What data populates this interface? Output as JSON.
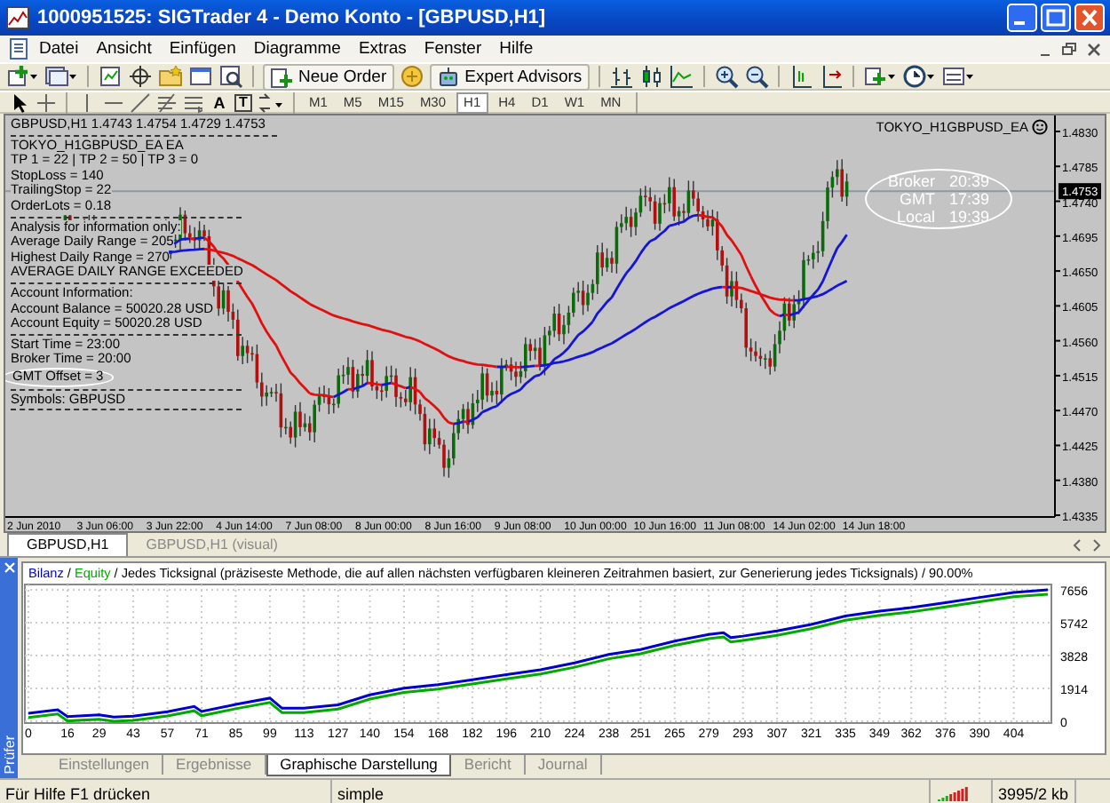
{
  "window": {
    "title": "1000951525: SIGTrader 4 - Demo Konto - [GBPUSD,H1]"
  },
  "menu": [
    "Datei",
    "Ansicht",
    "Einfügen",
    "Diagramme",
    "Extras",
    "Fenster",
    "Hilfe"
  ],
  "toolbar": {
    "buttons": [
      "Neue Order",
      "Expert Advisors"
    ]
  },
  "drawing_tools": [
    {
      "glyph": "A",
      "boxed": false
    },
    {
      "glyph": "T",
      "boxed": true
    }
  ],
  "timeframes": [
    {
      "label": "M1",
      "selected": false
    },
    {
      "label": "M5",
      "selected": false
    },
    {
      "label": "M15",
      "selected": false
    },
    {
      "label": "M30",
      "selected": false
    },
    {
      "label": "H1",
      "selected": true
    },
    {
      "label": "H4",
      "selected": false
    },
    {
      "label": "D1",
      "selected": false
    },
    {
      "label": "W1",
      "selected": false
    },
    {
      "label": "MN",
      "selected": false
    }
  ],
  "chart": {
    "header": "GBPUSD,H1  1.4743 1.4754 1.4729 1.4753",
    "ea_label": "TOKYO_H1GBPUSD_EA",
    "info_groups": [
      [
        {
          "text": "TOKYO_H1GBPUSD_EA EA",
          "circled": false
        },
        {
          "text": "TP 1 = 22 | TP 2 = 50 | TP 3 = 0",
          "circled": false
        },
        {
          "text": "StopLoss = 140",
          "circled": false
        },
        {
          "text": "TrailingStop = 22",
          "circled": false
        },
        {
          "text": "OrderLots = 0.18",
          "circled": false
        }
      ],
      [
        {
          "text": "Analysis for information only:",
          "circled": false
        },
        {
          "text": "Average Daily Range = 205",
          "circled": false
        },
        {
          "text": "Highest Daily Range = 270",
          "circled": false
        },
        {
          "text": "AVERAGE DAILY RANGE EXCEEDED",
          "circled": false
        }
      ],
      [
        {
          "text": "Account Information:",
          "circled": false
        },
        {
          "text": "Account Balance = 50020.28 USD",
          "circled": false
        },
        {
          "text": "Account Equity  = 50020.28 USD",
          "circled": false
        }
      ],
      [
        {
          "text": "Start Time = 23:00",
          "circled": false
        },
        {
          "text": "Broker Time = 20:00",
          "circled": false
        },
        {
          "text": "GMT Offset = 3",
          "circled": true
        }
      ],
      [
        {
          "text": "Symbols: GBPUSD",
          "circled": false
        }
      ]
    ],
    "clock": [
      {
        "label": "Broker",
        "time": "20:39"
      },
      {
        "label": "GMT",
        "time": "17:39"
      },
      {
        "label": "Local",
        "time": "19:39"
      }
    ],
    "price_labels": [
      "1.4830",
      "1.4785",
      "1.4740",
      "1.4695",
      "1.4650",
      "1.4605",
      "1.4560",
      "1.4515",
      "1.4470",
      "1.4425",
      "1.4380",
      "1.4335"
    ],
    "current_price": "1.4753",
    "time_labels": [
      "2 Jun 2010",
      "3 Jun 06:00",
      "3 Jun 22:00",
      "4 Jun 14:00",
      "7 Jun 08:00",
      "8 Jun 00:00",
      "8 Jun 16:00",
      "9 Jun 08:00",
      "10 Jun 00:00",
      "10 Jun 16:00",
      "11 Jun 08:00",
      "14 Jun 02:00",
      "14 Jun 18:00"
    ]
  },
  "chart_tabs": [
    {
      "label": "GBPUSD,H1",
      "selected": true
    },
    {
      "label": "GBPUSD,H1 (visual)",
      "selected": false
    }
  ],
  "tester": {
    "side_label": "Prüfer",
    "separators": [
      "/",
      "/"
    ],
    "description": "Jedes  Ticksignal (präziseste Methode, die auf allen nächsten verfügbaren kleineren Zeitrahmen basiert, zur Generierung jedes Ticksignals) / 90.00%",
    "chart_data": {
      "type": "line",
      "grid": true,
      "x": [
        0,
        12,
        16,
        29,
        35,
        43,
        57,
        68,
        71,
        85,
        99,
        104,
        113,
        127,
        140,
        154,
        168,
        182,
        196,
        210,
        224,
        238,
        251,
        265,
        279,
        285,
        288,
        293,
        307,
        321,
        335,
        349,
        362,
        376,
        390,
        404,
        418
      ],
      "series": [
        {
          "name": "Bilanz",
          "color": "#0000cc",
          "values": [
            470,
            670,
            270,
            370,
            250,
            300,
            560,
            860,
            570,
            980,
            1350,
            760,
            760,
            960,
            1540,
            1930,
            2130,
            2420,
            2720,
            3000,
            3400,
            3890,
            4180,
            4670,
            5060,
            5160,
            4870,
            4960,
            5260,
            5640,
            6130,
            6420,
            6620,
            6910,
            7210,
            7500,
            7650
          ]
        },
        {
          "name": "Equity",
          "color": "#00aa00",
          "values": [
            220,
            420,
            20,
            120,
            0,
            50,
            310,
            610,
            320,
            730,
            1100,
            510,
            510,
            710,
            1290,
            1680,
            1880,
            2170,
            2470,
            2750,
            3150,
            3640,
            3930,
            4420,
            4810,
            4910,
            4620,
            4710,
            5010,
            5390,
            5880,
            6170,
            6370,
            6660,
            6960,
            7250,
            7400
          ]
        }
      ],
      "xticks": [
        0,
        16,
        29,
        43,
        57,
        71,
        85,
        99,
        113,
        127,
        140,
        154,
        168,
        182,
        196,
        210,
        224,
        238,
        251,
        265,
        279,
        293,
        307,
        321,
        335,
        349,
        362,
        376,
        390,
        404
      ],
      "yticks": [
        0,
        1914,
        3828,
        5742,
        7656
      ],
      "ylim": [
        0,
        7656
      ],
      "xlim": [
        0,
        418
      ]
    },
    "tabs": [
      {
        "label": "Einstellungen",
        "selected": false
      },
      {
        "label": "Ergebnisse",
        "selected": false
      },
      {
        "label": "Graphische Darstellung",
        "selected": true
      },
      {
        "label": "Bericht",
        "selected": false
      },
      {
        "label": "Journal",
        "selected": false
      }
    ]
  },
  "status_bar": {
    "help": "Für Hilfe F1 drücken",
    "profile": "simple",
    "traffic": "3995/2 kb"
  }
}
